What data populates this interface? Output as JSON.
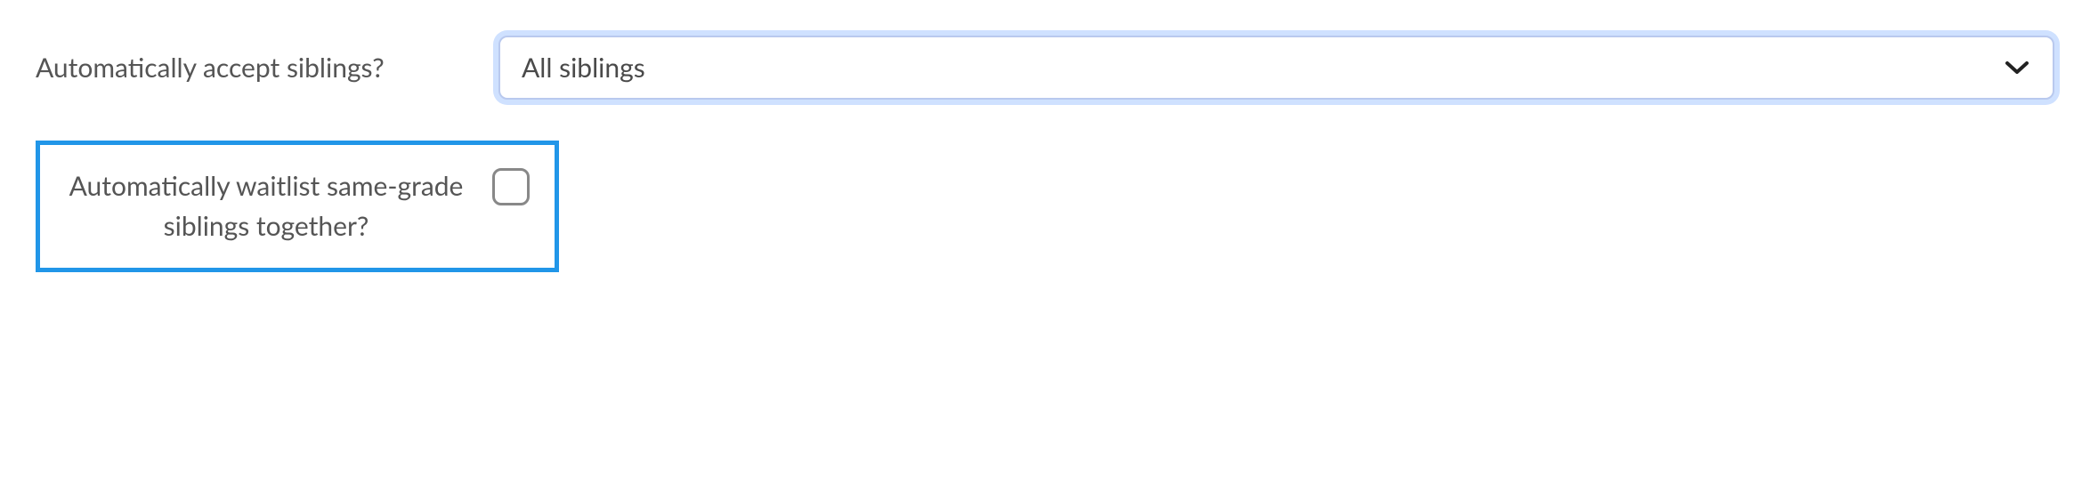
{
  "form": {
    "accept_siblings": {
      "label": "Automatically accept siblings?",
      "selected": "All siblings"
    },
    "waitlist_siblings": {
      "label": "Automatically waitlist same-grade siblings together?",
      "checked": false
    }
  }
}
